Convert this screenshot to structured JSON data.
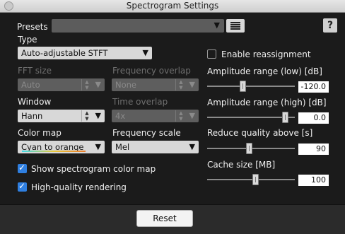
{
  "window": {
    "title": "Spectrogram Settings"
  },
  "presets": {
    "label": "Presets",
    "value": ""
  },
  "type": {
    "label": "Type",
    "value": "Auto-adjustable STFT"
  },
  "fft_size": {
    "label": "FFT size",
    "value": "Auto"
  },
  "frequency_overlap": {
    "label": "Frequency overlap",
    "value": "None"
  },
  "window_fn": {
    "label": "Window",
    "value": "Hann"
  },
  "time_overlap": {
    "label": "Time overlap",
    "value": "4x"
  },
  "color_map": {
    "label": "Color map",
    "value": "Cyan to orange"
  },
  "frequency_scale": {
    "label": "Frequency scale",
    "value": "Mel"
  },
  "checkboxes": {
    "show_colormap": {
      "label": "Show spectrogram color map",
      "checked": true
    },
    "high_quality": {
      "label": "High-quality rendering",
      "checked": true
    },
    "enable_reassignment": {
      "label": "Enable reassignment",
      "checked": false
    }
  },
  "sliders": {
    "amp_low": {
      "label": "Amplitude range (low)",
      "unit": "[dB]",
      "value": "-120.0",
      "level": 0.4
    },
    "amp_high": {
      "label": "Amplitude range (high)",
      "unit": "[dB]",
      "value": "0.0",
      "level": 0.92
    },
    "reduce_quality": {
      "label": "Reduce quality above [s]",
      "value": "90",
      "level": 0.48
    },
    "cache_size": {
      "label": "Cache size [MB]",
      "value": "100",
      "level": 0.56
    }
  },
  "buttons": {
    "reset": "Reset",
    "help": "?"
  },
  "colors": {
    "accent": "#2f7fe0",
    "background": "#1b1b1b"
  }
}
